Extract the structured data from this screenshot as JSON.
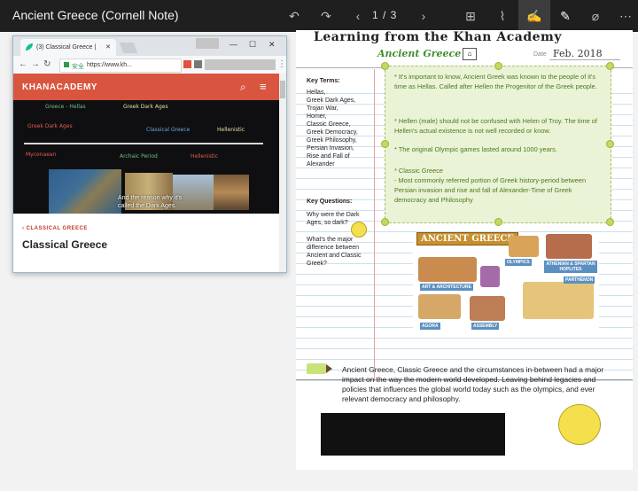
{
  "app": {
    "title": "Ancient Greece (Cornell Note)",
    "page_indicator": "1 / 3",
    "toolbar_icons": [
      "undo-icon",
      "redo-icon",
      "chevron-left-icon",
      "chevron-right-icon",
      "grid-icon",
      "paperclip-icon",
      "touch-draw-icon",
      "pen-icon",
      "eraser-icon",
      "more-icon"
    ]
  },
  "browser": {
    "tab_title": "(3) Classical Greece |",
    "secure_label": "安全",
    "url": "https://www.kh...",
    "site_logo": "KHANACADEMY",
    "video_caption": "And the reason why it's called the Dark Ages.",
    "video_labels": [
      "Greece - Hellas",
      "Greek Dark Ages",
      "Classical Greece",
      "Hellenistic"
    ],
    "breadcrumb": "‹ CLASSICAL GREECE",
    "page_title": "Classical Greece"
  },
  "note": {
    "title": "Learning from the Khan Academy",
    "subtitle": "Ancient Greece",
    "date_label": "Date",
    "date_value": "Feb. 2018",
    "key_terms_label": "Key Terms:",
    "key_terms": "Hellas,\nGreek Dark Ages,\nTrojan War,\nHomer,\nClassic Greece,\nGreek Democracy,\nGreek Philosophy,\nPersian Invasion,\nRise and Fall of\nAlexander",
    "key_questions_label": "Key Questions:",
    "key_q1": "Why were the Dark Ages, so dark?",
    "key_q2": "What's the major difference between Ancient and Classic Greek?",
    "notes": [
      "* It's important to know, Ancient Greek was known to the people of it's time as Hellas. Called after Hellen the Progenitor of the Greek people.",
      "* Hellen (male) should not be confused with Helen of Troy. The time of Hellen's actual existence is not well recorded or know.",
      "* The original Olympic games lasted around 1000 years.",
      "* Classic Greece\n- Most commonly referred portion of Greek history-period between Persian invasion and rise and fall of Alexander-Time of Greek democracy and Philosophy"
    ],
    "collage_title": "ANCIENT GREECE",
    "collage_labels": [
      "OLYMPICS",
      "ATHENIAN & SPARTAN HOPLITES",
      "ART & ARCHITECTURE",
      "PARTHENON",
      "AGORA",
      "ASSEMBLY"
    ],
    "summary": "Ancient Greece, Classic Greece and the circumstances in-between had a major impact on the way the modern world developed. Leaving behind legacies and policies that influences the global world today such as the olympics, and ever relevant democracy and philosophy."
  }
}
